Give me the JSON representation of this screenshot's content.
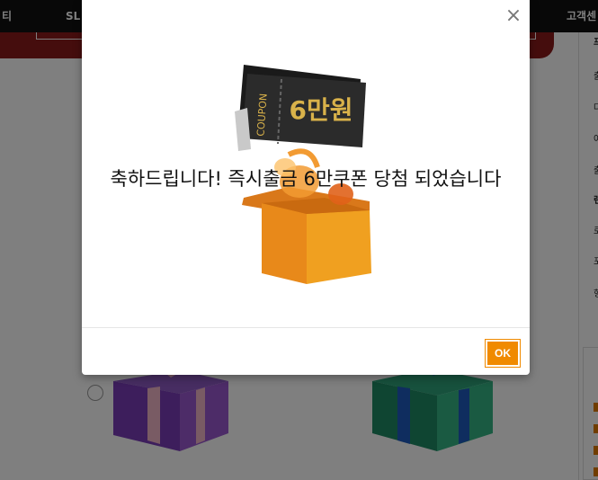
{
  "nav": {
    "items": [
      "티",
      "SL",
      "고객센"
    ]
  },
  "modal": {
    "message": "축하드립니다! 즉시출금 6만쿠폰 당첨 되었습니다",
    "coupon_label": "COUPON",
    "coupon_amount": "6만원",
    "ok_label": "OK",
    "close_label": "×"
  },
  "right_panel": {
    "items": [
      "프",
      "출",
      "다",
      "아",
      "출",
      "랜",
      "로",
      "포",
      "헝"
    ]
  },
  "colors": {
    "accent": "#f08a00",
    "coupon_gold": "#d9b24a",
    "header_bg": "#111111",
    "redbar_bg": "#8b1a1a"
  },
  "icons": {
    "close": "close-icon",
    "coupon": "coupon-ticket-icon",
    "box": "gift-box-icon"
  }
}
